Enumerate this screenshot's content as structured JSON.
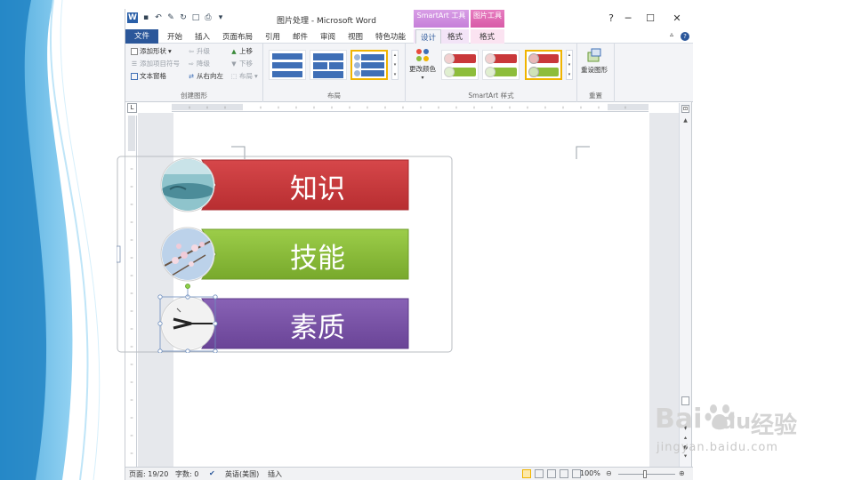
{
  "window": {
    "title": "图片处理 - Microsoft Word",
    "context_tabs": {
      "smartart_tools": "SmartArt 工具",
      "picture_tools": "图片工具"
    }
  },
  "qat": {
    "logo": "W",
    "customize": "▾"
  },
  "tabs": {
    "file": "文件",
    "home": "开始",
    "insert": "插入",
    "page_layout": "页面布局",
    "references": "引用",
    "mailings": "邮件",
    "review": "审阅",
    "view": "视图",
    "features": "特色功能",
    "design": "设计",
    "format": "格式",
    "format2": "格式"
  },
  "ribbon": {
    "create_graphic": {
      "label": "创建图形",
      "add_shape": "添加形状",
      "add_bullet": "添加项目符号",
      "text_pane": "文本窗格",
      "promote": "升级",
      "demote": "降级",
      "right_to_left": "从右向左",
      "move_up": "上移",
      "move_down": "下移",
      "layout": "布局"
    },
    "layouts": {
      "label": "布局"
    },
    "styles": {
      "label": "SmartArt 样式",
      "change_colors": "更改颜色"
    },
    "reset": {
      "label": "重置",
      "reset_graphic": "重设图形"
    }
  },
  "smartart": {
    "items": [
      {
        "text": "知识",
        "color": "#c9383a"
      },
      {
        "text": "技能",
        "color": "#8dbd3b"
      },
      {
        "text": "素质",
        "color": "#7b55a8"
      }
    ]
  },
  "statusbar": {
    "page": "页面: 19/20",
    "words": "字数: 0",
    "language": "英语(美国)",
    "mode": "插入",
    "zoom": "100%"
  },
  "watermark": {
    "brand": "Bai",
    "brand2": "du",
    "cn": "经验",
    "url": "jingyan.baidu.com"
  },
  "colors": {
    "file_tab": "#2b579a",
    "accent_blue": "#3f6fb6",
    "selection_gold": "#f0b400"
  }
}
